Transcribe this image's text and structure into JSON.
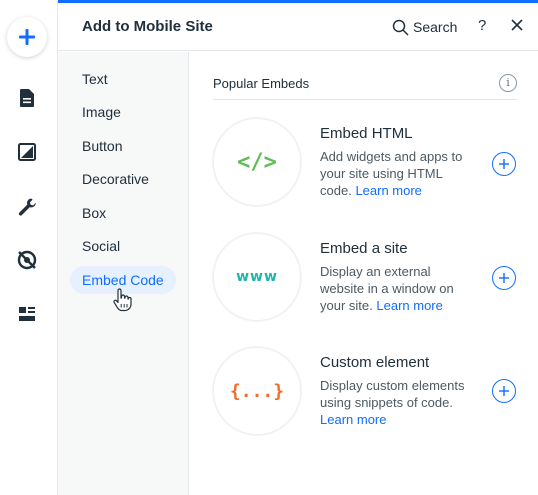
{
  "panel": {
    "title": "Add to Mobile Site",
    "search_label": "Search",
    "help_label": "?"
  },
  "rail": {
    "icons": [
      "add-icon",
      "page-icon",
      "background-icon",
      "tools-icon",
      "hidden-elements-icon",
      "layout-icon"
    ]
  },
  "categories": [
    {
      "label": "Text",
      "active": false
    },
    {
      "label": "Image",
      "active": false
    },
    {
      "label": "Button",
      "active": false
    },
    {
      "label": "Decorative",
      "active": false
    },
    {
      "label": "Box",
      "active": false
    },
    {
      "label": "Social",
      "active": false
    },
    {
      "label": "Embed Code",
      "active": true
    }
  ],
  "section": {
    "title": "Popular Embeds",
    "info_label": "i"
  },
  "items": [
    {
      "name": "Embed HTML",
      "icon_text": "</>",
      "icon_color": "#60bc57",
      "desc_lines": [
        "Add widgets and apps to",
        "your site using HTML",
        "code."
      ],
      "link": "Learn more"
    },
    {
      "name": "Embed a site",
      "icon_text": "www",
      "icon_color": "#1fb5a8",
      "desc_lines": [
        "Display an external",
        "website in a window on",
        "your site."
      ],
      "link": "Learn more"
    },
    {
      "name": "Custom element",
      "icon_text": "{...}",
      "icon_color": "#f26b2a",
      "desc_lines": [
        "Display custom elements",
        "using snippets of code."
      ],
      "link": "Learn more"
    }
  ],
  "colors": {
    "accent": "#116dff",
    "active_bg": "#e7f0ff"
  }
}
